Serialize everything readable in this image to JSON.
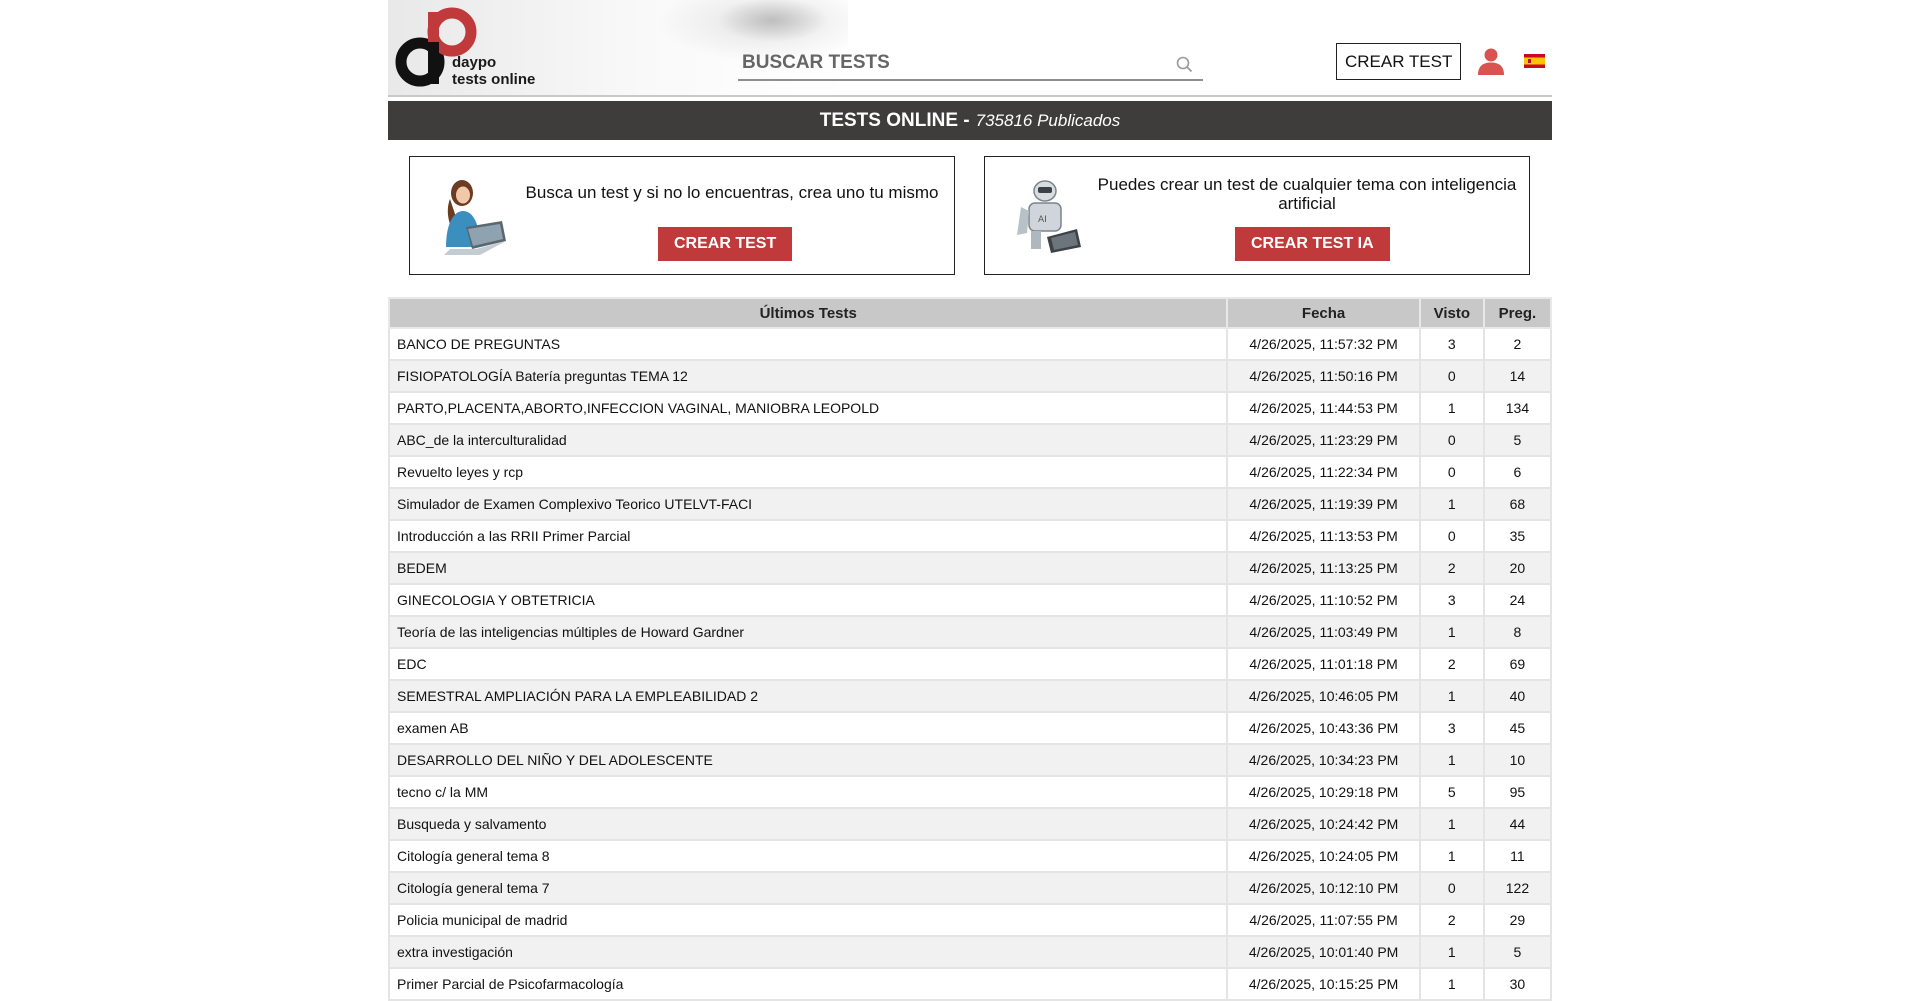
{
  "header": {
    "logo_line1": "daypo",
    "logo_line2": "tests online",
    "search_placeholder": "BUSCAR TESTS",
    "crear_test": "CREAR TEST"
  },
  "titlebar": {
    "title": "TESTS ONLINE -",
    "count": "735816 Publicados"
  },
  "promos": [
    {
      "text": "Busca un test y si no lo encuentras, crea uno tu mismo",
      "button": "CREAR TEST"
    },
    {
      "text": "Puedes crear un test de cualquier tema con inteligencia artificial",
      "button": "CREAR TEST IA"
    }
  ],
  "table": {
    "headers": [
      "Últimos Tests",
      "Fecha",
      "Visto",
      "Preg."
    ],
    "rows": [
      [
        "BANCO DE PREGUNTAS",
        "4/26/2025, 11:57:32 PM",
        "3",
        "2"
      ],
      [
        "FISIOPATOLOGÍA Batería preguntas TEMA 12",
        "4/26/2025, 11:50:16 PM",
        "0",
        "14"
      ],
      [
        "PARTO,PLACENTA,ABORTO,INFECCION VAGINAL, MANIOBRA LEOPOLD",
        "4/26/2025, 11:44:53 PM",
        "1",
        "134"
      ],
      [
        "ABC_de la interculturalidad",
        "4/26/2025, 11:23:29 PM",
        "0",
        "5"
      ],
      [
        "Revuelto leyes y rcp",
        "4/26/2025, 11:22:34 PM",
        "0",
        "6"
      ],
      [
        "Simulador de Examen Complexivo Teorico UTELVT-FACI",
        "4/26/2025, 11:19:39 PM",
        "1",
        "68"
      ],
      [
        "Introducción a las RRII Primer Parcial",
        "4/26/2025, 11:13:53 PM",
        "0",
        "35"
      ],
      [
        "BEDEM",
        "4/26/2025, 11:13:25 PM",
        "2",
        "20"
      ],
      [
        "GINECOLOGIA Y OBTETRICIA",
        "4/26/2025, 11:10:52 PM",
        "3",
        "24"
      ],
      [
        "Teoría de las inteligencias múltiples de Howard Gardner",
        "4/26/2025, 11:03:49 PM",
        "1",
        "8"
      ],
      [
        "EDC",
        "4/26/2025, 11:01:18 PM",
        "2",
        "69"
      ],
      [
        "SEMESTRAL AMPLIACIÓN PARA LA EMPLEABILIDAD 2",
        "4/26/2025, 10:46:05 PM",
        "1",
        "40"
      ],
      [
        "examen AB",
        "4/26/2025, 10:43:36 PM",
        "3",
        "45"
      ],
      [
        "DESARROLLO DEL NIÑO Y DEL ADOLESCENTE",
        "4/26/2025, 10:34:23 PM",
        "1",
        "10"
      ],
      [
        "tecno c/ la MM",
        "4/26/2025, 10:29:18 PM",
        "5",
        "95"
      ],
      [
        "Busqueda y salvamento",
        "4/26/2025, 10:24:42 PM",
        "1",
        "44"
      ],
      [
        "Citología general tema 8",
        "4/26/2025, 10:24:05 PM",
        "1",
        "11"
      ],
      [
        "Citología general tema 7",
        "4/26/2025, 10:12:10 PM",
        "0",
        "122"
      ],
      [
        "Policia municipal de madrid",
        "4/26/2025, 11:07:55 PM",
        "2",
        "29"
      ],
      [
        "extra investigación",
        "4/26/2025, 10:01:40 PM",
        "1",
        "5"
      ],
      [
        "Primer Parcial de Psicofarmacología",
        "4/26/2025, 10:15:25 PM",
        "1",
        "30"
      ]
    ]
  },
  "colors": {
    "accent_red": "#c0393b",
    "titlebar_bg": "#3f3c3c",
    "user_icon": "#d9534f"
  }
}
